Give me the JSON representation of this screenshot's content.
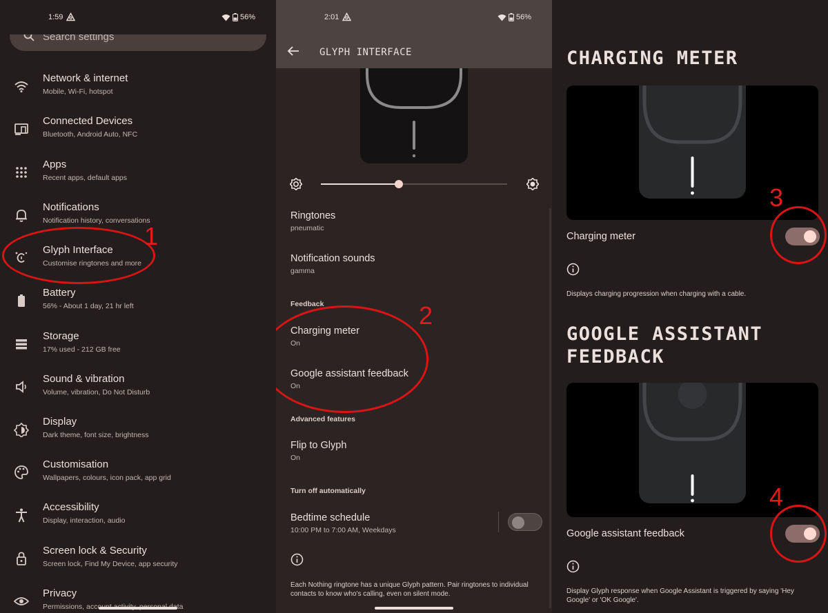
{
  "panel1": {
    "status": {
      "time": "1:59",
      "battery": "56%"
    },
    "search": {
      "placeholder": "Search settings"
    },
    "items": [
      {
        "icon": "wifi-icon",
        "title": "Network & internet",
        "subtitle": "Mobile, Wi-Fi, hotspot"
      },
      {
        "icon": "devices-icon",
        "title": "Connected Devices",
        "subtitle": "Bluetooth, Android Auto, NFC"
      },
      {
        "icon": "apps-icon",
        "title": "Apps",
        "subtitle": "Recent apps, default apps"
      },
      {
        "icon": "bell-icon",
        "title": "Notifications",
        "subtitle": "Notification history, conversations"
      },
      {
        "icon": "glyph-icon",
        "title": "Glyph Interface",
        "subtitle": "Customise ringtones and more"
      },
      {
        "icon": "battery-icon",
        "title": "Battery",
        "subtitle": "56% - About 1 day, 21 hr left"
      },
      {
        "icon": "storage-icon",
        "title": "Storage",
        "subtitle": "17% used - 212 GB free"
      },
      {
        "icon": "volume-icon",
        "title": "Sound & vibration",
        "subtitle": "Volume, vibration, Do Not Disturb"
      },
      {
        "icon": "display-icon",
        "title": "Display",
        "subtitle": "Dark theme, font size, brightness"
      },
      {
        "icon": "palette-icon",
        "title": "Customisation",
        "subtitle": "Wallpapers, colours, icon pack, app grid"
      },
      {
        "icon": "accessibility-icon",
        "title": "Accessibility",
        "subtitle": "Display, interaction, audio"
      },
      {
        "icon": "lock-icon",
        "title": "Screen lock & Security",
        "subtitle": "Screen lock, Find My Device, app security"
      },
      {
        "icon": "eye-icon",
        "title": "Privacy",
        "subtitle": "Permissions, account activity, personal data"
      }
    ]
  },
  "panel2": {
    "status": {
      "time": "2:01",
      "battery": "56%"
    },
    "title": "GLYPH INTERFACE",
    "brightness": 0.42,
    "rows": {
      "ringtones": {
        "title": "Ringtones",
        "subtitle": "pneumatic"
      },
      "notification_sounds": {
        "title": "Notification sounds",
        "subtitle": "gamma"
      },
      "feedback_header": "Feedback",
      "charging_meter": {
        "title": "Charging meter",
        "subtitle": "On"
      },
      "google_assistant": {
        "title": "Google assistant feedback",
        "subtitle": "On"
      },
      "advanced_header": "Advanced features",
      "flip": {
        "title": "Flip to Glyph",
        "subtitle": "On"
      },
      "auto_header": "Turn off automatically",
      "bedtime": {
        "title": "Bedtime schedule",
        "subtitle": "10:00 PM to 7:00 AM, Weekdays",
        "enabled": false
      }
    },
    "footnote": "Each Nothing ringtone has a unique Glyph pattern. Pair ringtones to individual contacts to know who's calling, even on silent mode."
  },
  "panel3": {
    "charging": {
      "heading": "CHARGING METER",
      "label": "Charging meter",
      "enabled": true,
      "description": "Displays charging progression when charging with a cable."
    },
    "assistant": {
      "heading_line1": "GOOGLE ASSISTANT",
      "heading_line2": "FEEDBACK",
      "label": "Google assistant feedback",
      "enabled": true,
      "description_line1": "Display Glyph response when Google Assistant is triggered by saying 'Hey",
      "description_line2": "Google' or 'OK Google'."
    }
  },
  "annotations": {
    "n1": "1",
    "n2": "2",
    "n3": "3",
    "n4": "4"
  },
  "colors": {
    "annotation_red": "#e01c1c",
    "accent_toggle": "#8d6d6a",
    "toggle_knob": "#ffdad3"
  }
}
